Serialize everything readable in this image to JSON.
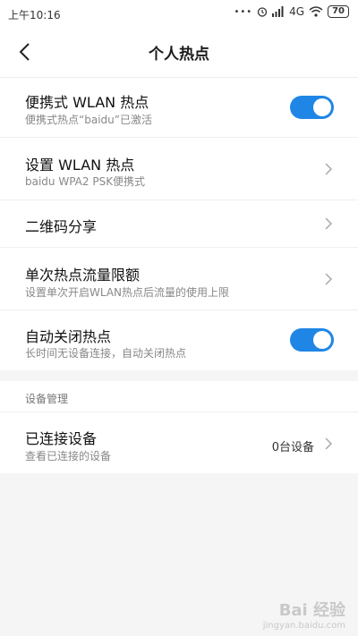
{
  "status": {
    "time": "上午10:16",
    "network": "4G",
    "battery": "70"
  },
  "header": {
    "title": "个人热点"
  },
  "rows": {
    "portable": {
      "title": "便携式 WLAN 热点",
      "subtitle": "便携式热点“baidu”已激活",
      "enabled": true
    },
    "setup": {
      "title": "设置 WLAN 热点",
      "subtitle": "baidu WPA2 PSK便携式"
    },
    "qr": {
      "title": "二维码分享"
    },
    "limit": {
      "title": "单次热点流量限额",
      "subtitle": "设置单次开启WLAN热点后流量的使用上限"
    },
    "autoclose": {
      "title": "自动关闭热点",
      "subtitle": "长时间无设备连接，自动关闭热点",
      "enabled": true
    }
  },
  "device_section": {
    "header": "设备管理",
    "connected": {
      "title": "已连接设备",
      "subtitle": "查看已连接的设备",
      "value": "0台设备"
    }
  },
  "watermark": {
    "main": "Bai 经验",
    "sub": "jingyan.baidu.com"
  },
  "colors": {
    "accent": "#1f86e6"
  },
  "icons": [
    "back-arrow-icon",
    "chevron-right-icon",
    "wifi-icon",
    "signal-icon",
    "alarm-icon"
  ]
}
